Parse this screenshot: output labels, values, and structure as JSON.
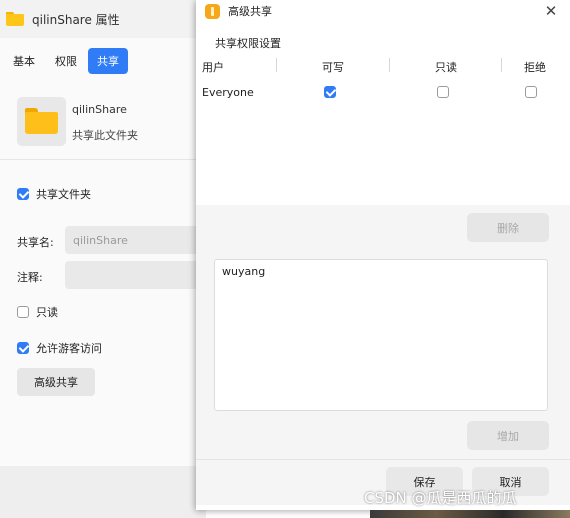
{
  "props_window": {
    "title": "qilinShare 属性",
    "tabs": [
      {
        "label": "基本",
        "active": false
      },
      {
        "label": "权限",
        "active": false
      },
      {
        "label": "共享",
        "active": true
      }
    ],
    "folder_name": "qilinShare",
    "folder_sub": "共享此文件夹",
    "share_folder": {
      "label": "共享文件夹",
      "checked": true
    },
    "share_name": {
      "label": "共享名:",
      "value": "qilinShare"
    },
    "comment": {
      "label": "注释:",
      "value": ""
    },
    "readonly": {
      "label": "只读",
      "checked": false
    },
    "guest": {
      "label": "允许游客访问",
      "checked": true
    },
    "advanced_button": "高级共享"
  },
  "dialog": {
    "title": "高级共享",
    "close_icon": "close-icon",
    "section_title": "共享权限设置",
    "columns": [
      "用户",
      "可写",
      "只读",
      "拒绝"
    ],
    "rows": [
      {
        "user": "Everyone",
        "writable": true,
        "readonly": false,
        "deny": false
      }
    ],
    "delete_button": "删除",
    "user_input_value": "wuyang",
    "add_button": "增加",
    "save_button": "保存",
    "cancel_button": "取消"
  },
  "watermark": "CSDN @瓜是西瓜的瓜",
  "colors": {
    "accent": "#2f7cf6",
    "folder": "#ffbf1a"
  }
}
